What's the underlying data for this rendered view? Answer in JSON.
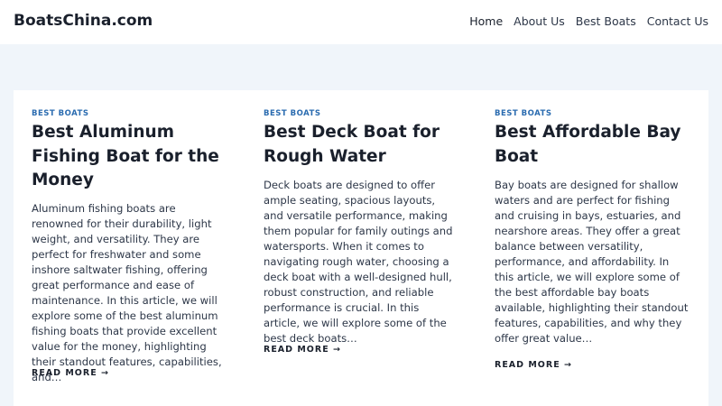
{
  "site": {
    "logo": "BoatsChina.com"
  },
  "nav": {
    "items": [
      {
        "label": "Home"
      },
      {
        "label": "About Us"
      },
      {
        "label": "Best Boats"
      },
      {
        "label": "Contact Us"
      }
    ]
  },
  "posts": [
    {
      "category": "BEST BOATS",
      "title": "Best Aluminum Fishing Boat for the Money",
      "excerpt": "Aluminum fishing boats are renowned for their durability, light weight, and versatility. They are perfect for freshwater and some inshore saltwater fishing, offering great performance and ease of maintenance. In this article, we will explore some of the best aluminum fishing boats that provide excellent value for the money, highlighting their standout features, capabilities, and…",
      "read_more": "READ MORE →"
    },
    {
      "category": "BEST BOATS",
      "title": "Best Deck Boat for Rough Water",
      "excerpt": "Deck boats are designed to offer ample seating, spacious layouts, and versatile performance, making them popular for family outings and watersports. When it comes to navigating rough water, choosing a deck boat with a well-designed hull, robust construction, and reliable performance is crucial. In this article, we will explore some of the best deck boats…",
      "read_more": "READ MORE →"
    },
    {
      "category": "BEST BOATS",
      "title": "Best Affordable Bay Boat",
      "excerpt": "Bay boats are designed for shallow waters and are perfect for fishing and cruising in bays, estuaries, and nearshore areas. They offer a great balance between versatility, performance, and affordability. In this article, we will explore some of the best affordable bay boats available, highlighting their standout features, capabilities, and why they offer great value…",
      "read_more": "READ MORE →"
    }
  ]
}
